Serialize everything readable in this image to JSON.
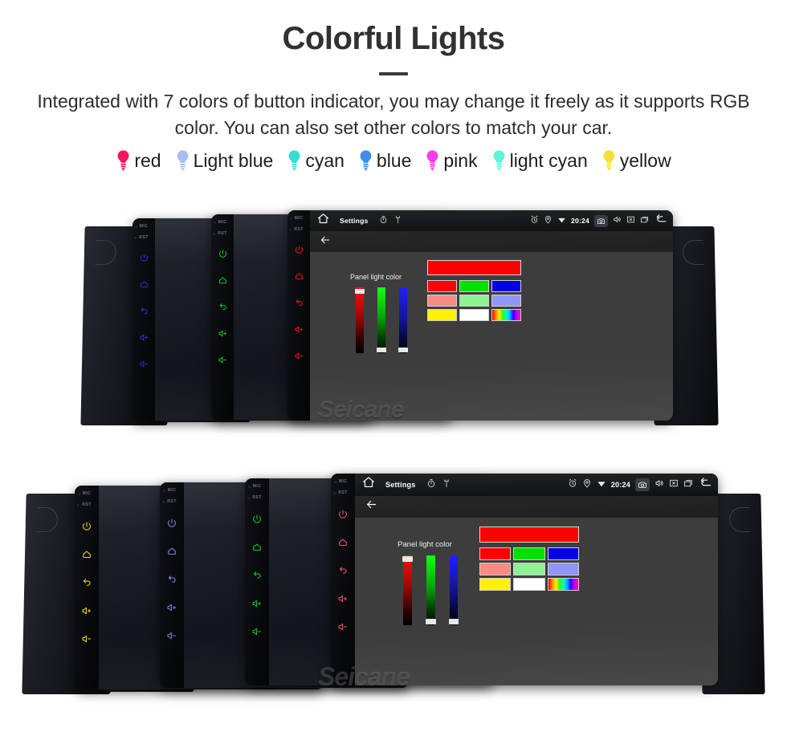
{
  "header": {
    "title": "Colorful Lights",
    "subtitle": "Integrated with 7 colors of button indicator, you may change it freely as it supports RGB color. You can also set other colors to match your car."
  },
  "legend": {
    "items": [
      {
        "label": "red",
        "color": "#f5155e",
        "icon": "light-bulb-icon"
      },
      {
        "label": "Light blue",
        "color": "#a8bdf6",
        "icon": "light-bulb-icon"
      },
      {
        "label": "cyan",
        "color": "#34dcd2",
        "icon": "light-bulb-icon"
      },
      {
        "label": "blue",
        "color": "#3f8ced",
        "icon": "light-bulb-icon"
      },
      {
        "label": "pink",
        "color": "#f73df0",
        "icon": "light-bulb-icon"
      },
      {
        "label": "light cyan",
        "color": "#5cf5dc",
        "icon": "light-bulb-icon"
      },
      {
        "label": "yellow",
        "color": "#f2e03c",
        "icon": "light-bulb-icon"
      }
    ]
  },
  "device_screen": {
    "status_bar": {
      "home_icon": "home-icon",
      "title": "Settings",
      "timer_icon": "timer-icon",
      "usb_icon": "usb-icon",
      "alarm_icon": "alarm-icon",
      "location_icon": "location-icon",
      "wifi_icon": "wifi-icon",
      "time": "20:24",
      "camera_icon": "camera-icon",
      "volume_icon": "volume-icon",
      "close_icon": "close-box-icon",
      "recents_icon": "recent-apps-icon",
      "back_icon": "back-arrow-icon"
    },
    "action_bar": {
      "back_icon": "back-arrow-icon"
    },
    "panel": {
      "label": "Panel light color",
      "sliders": [
        {
          "name": "red-slider",
          "channel": "R",
          "knob_position": "top"
        },
        {
          "name": "green-slider",
          "channel": "G",
          "knob_position": "bottom"
        },
        {
          "name": "blue-slider",
          "channel": "B",
          "knob_position": "bottom"
        }
      ],
      "preview_color": "#ff0000",
      "swatches": [
        [
          "#ff0000",
          "#00e000",
          "#0000e8"
        ],
        [
          "#f98a84",
          "#8ef293",
          "#9096f7"
        ],
        [
          "#fff200",
          "#ffffff",
          "rainbow"
        ]
      ]
    },
    "watermark": "Seicane"
  },
  "key_strip": {
    "mic_label": "MIC",
    "rst_label": "RST",
    "keys": [
      {
        "name": "power-icon",
        "label": "power"
      },
      {
        "name": "home-icon",
        "label": "home"
      },
      {
        "name": "back-icon",
        "label": "back"
      },
      {
        "name": "volume-up-icon",
        "label": "volume up"
      },
      {
        "name": "volume-down-icon",
        "label": "volume down"
      }
    ]
  },
  "device_groups": [
    {
      "name": "top-device-row",
      "units": [
        {
          "key_color": "#2a2fd6",
          "active": false
        },
        {
          "key_color": "#16c41c",
          "active": false
        },
        {
          "key_color": "#e81616",
          "active": true
        }
      ]
    },
    {
      "name": "bottom-device-row",
      "units": [
        {
          "key_color": "#e8d21c",
          "active": false
        },
        {
          "key_color": "#7b7fe8",
          "active": false
        },
        {
          "key_color": "#16c41c",
          "active": false
        },
        {
          "key_color": "#e8506b",
          "active": true
        }
      ]
    }
  ]
}
